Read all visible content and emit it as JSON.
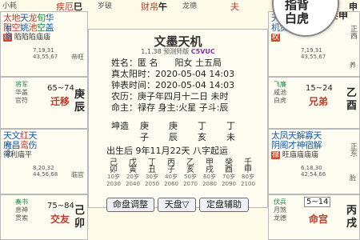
{
  "top_strip": {
    "left_label": "小耗",
    "mid_left_label": "疾厄",
    "mid_left_branch": "巳",
    "mid_label": "岁破",
    "mid_palace": "财帛",
    "mid_branch": "午",
    "right_label": "龙德",
    "right_palace": "夫",
    "right_branch": "申",
    "magnifier_lines": [
      "指背",
      "白虎"
    ]
  },
  "cells": {
    "top_left": {
      "stars": [
        "太",
        "地",
        "天",
        "龙",
        "旬",
        "华"
      ],
      "stars2": [
        "阳",
        "空",
        "姚",
        "池",
        "空",
        "盖"
      ],
      "tag": "科",
      "brightness": [
        "陷",
        "陷",
        "陷",
        "庙",
        "庙"
      ],
      "ages": [
        "7,19,31",
        "43,55,67"
      ],
      "side_left": "东临",
      "god": "帝旺",
      "minor": "将军",
      "minor2": "华盖",
      "minor3": "官符",
      "range": "65~74",
      "palace": "迁移",
      "stem": "庚",
      "branch": "辰"
    },
    "top_right": {
      "stars": [
        "天",
        "天",
        "天",
        "封",
        "咸"
      ],
      "stars2": [
        "机",
        "贵",
        "诰",
        "池",
        "池"
      ],
      "tag": "权",
      "palace": "妻",
      "branch": "申",
      "ages": [
        "7,19,31",
        "43,55,67"
      ],
      "side_right": "正西",
      "god": "养",
      "minor": "飞廉",
      "minor2": "咸池",
      "minor3": "白虎",
      "range": "15~24",
      "palace2": "兄弟",
      "stem": "乙",
      "branch2": "酉"
    },
    "mid_left": {
      "stars": [
        "天",
        "文",
        "红",
        "天"
      ],
      "stars2": [
        "府",
        "昌",
        "鸾",
        "伤"
      ],
      "brightness": [
        "得",
        "利",
        "庙",
        "平"
      ],
      "ages": [
        "8,20,32",
        "44,56,68"
      ],
      "side_left": "东北",
      "god": "临官",
      "minor": "奏书",
      "minor2": "息神",
      "minor3": "贯索",
      "range": "75~84",
      "palace": "交友",
      "stem": "己",
      "branch": "卯"
    },
    "mid_right": {
      "stars": [
        "太",
        "凤",
        "天",
        "解",
        "寡",
        "天"
      ],
      "stars2": [
        "阴",
        "阁",
        "才",
        "神",
        "宿",
        "解"
      ],
      "tag": "禄",
      "brightness": [
        "旺",
        "庙",
        "庙",
        "庙",
        "庙"
      ],
      "ages": [
        "6,18,30",
        "42,54,66"
      ],
      "side_right": "正东",
      "god": "胎",
      "minor": "伏兵",
      "minor2": "月煞",
      "minor3": "龙德",
      "range": "5~14",
      "palace": "命宫",
      "stem": "丙",
      "branch": "戌"
    }
  },
  "center": {
    "title": "文墨天机",
    "version": "1.1.38 预测师版",
    "badge": "C5VUC",
    "info": [
      {
        "k": "姓名：",
        "v": "匿 名",
        "k2": "阳女 土五局"
      },
      {
        "k": "真太阳时：",
        "v": "2020-05-04 14:03"
      },
      {
        "k": "钟表时间：",
        "v": "2020-05-04 14:03"
      },
      {
        "k": "农历：",
        "v": "庚子年四月十二日 未时"
      },
      {
        "k": "命主：",
        "v": "禄存 身主:火星 子斗:辰"
      }
    ],
    "pillars_label": "坤造",
    "pillars_top": [
      "庚",
      "庚",
      "丁",
      "丁"
    ],
    "pillars_bottom": [
      "子",
      "辰",
      "亥",
      "未"
    ],
    "start_luck": "出生后 9年11月22天 八字起运",
    "luck_stems": [
      "己",
      "戊",
      "丁",
      "丙",
      "乙",
      "甲",
      "癸",
      "壬"
    ],
    "luck_branches": [
      "卯",
      "寅",
      "丑",
      "子",
      "亥",
      "戌",
      "酉",
      "申"
    ],
    "luck_ages": [
      "10岁",
      "20岁",
      "30岁",
      "40岁",
      "50岁",
      "60岁",
      "70岁",
      "80岁"
    ],
    "luck_years": [
      "2030",
      "2040",
      "2050",
      "2060",
      "2070",
      "2080",
      "2090",
      "2100"
    ],
    "buttons": [
      "命盘调整",
      "天盘▽",
      "定盘辅助"
    ]
  },
  "bottom_right_box": "5~14"
}
